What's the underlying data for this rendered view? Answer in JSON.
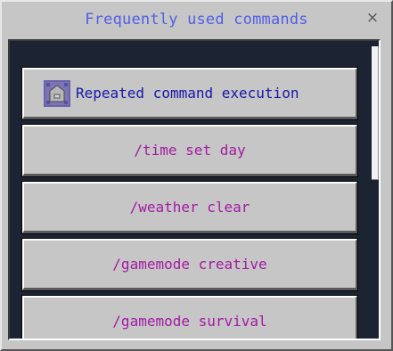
{
  "dialog": {
    "title": "Frequently used commands",
    "close_label": "×"
  },
  "commands": [
    {
      "label": "Repeated command execution",
      "icon": "command-block-icon"
    },
    {
      "label": "/time set day"
    },
    {
      "label": "/weather clear"
    },
    {
      "label": "/gamemode creative"
    },
    {
      "label": "/gamemode survival"
    }
  ],
  "colors": {
    "title": "#4f5fe6",
    "primary_command_text": "#1717a8",
    "command_text": "#a31aa3",
    "panel_background": "#1c2333"
  }
}
